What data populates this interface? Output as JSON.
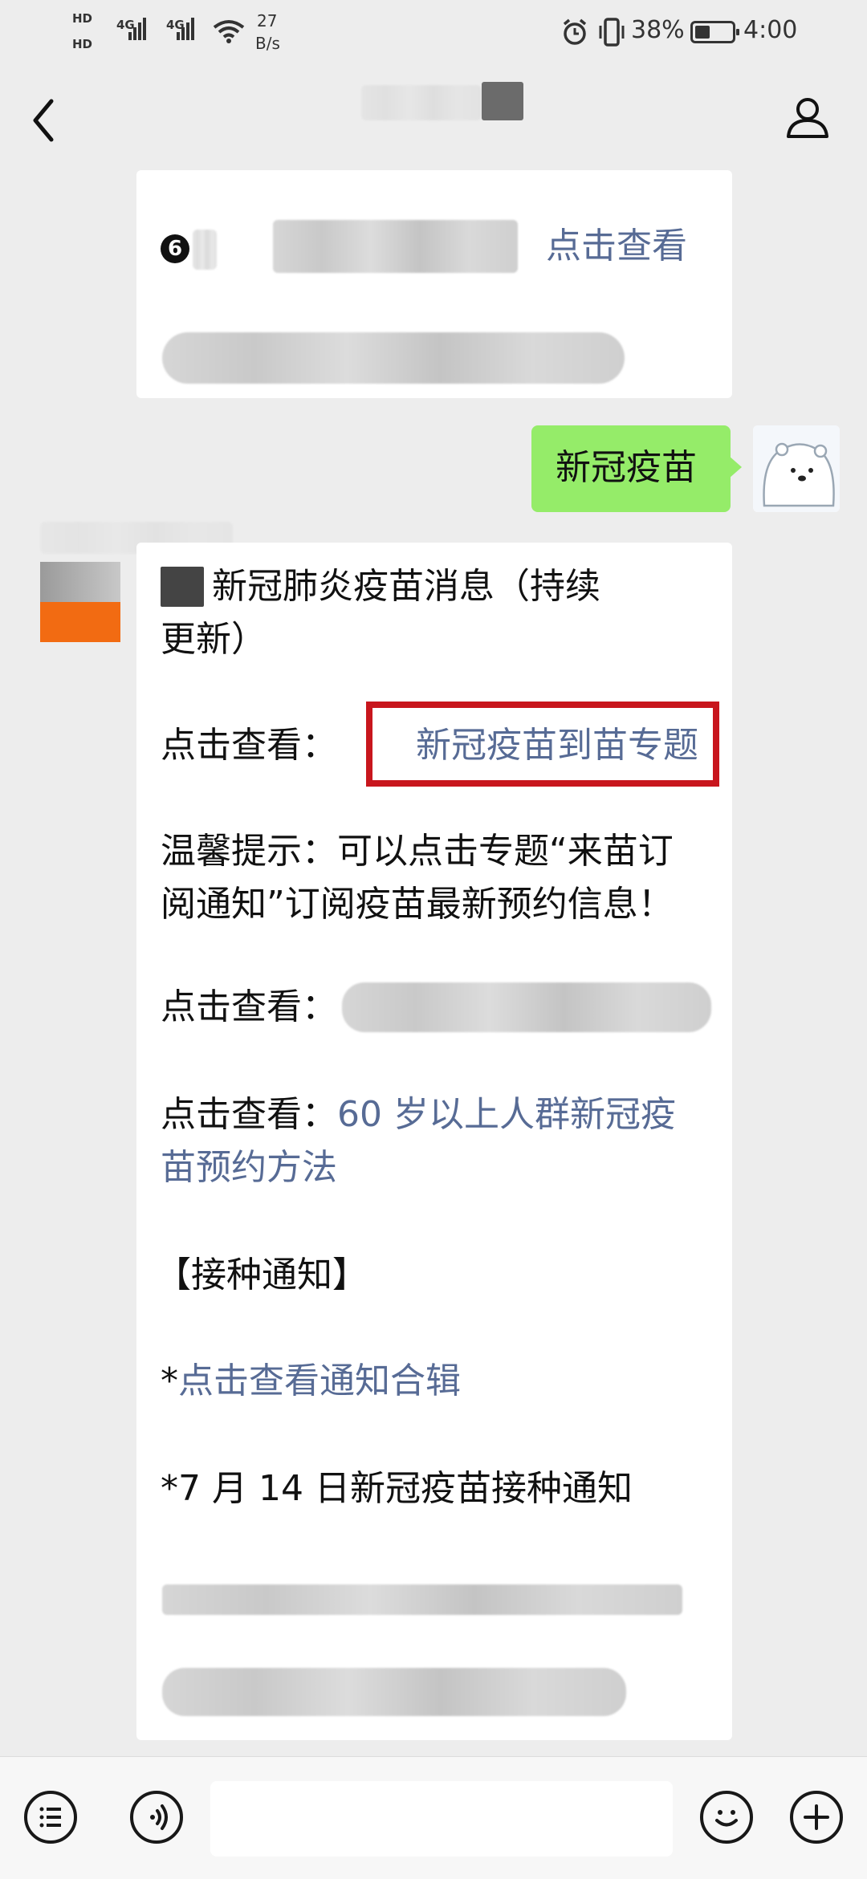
{
  "status_bar": {
    "hd1": "HD",
    "hd2": "HD",
    "net1": "4G",
    "net2": "4G",
    "speed_value": "27",
    "speed_unit": "B/s",
    "battery": "38%",
    "time": "4:00"
  },
  "nav": {
    "back_icon": "chevron-left-icon",
    "profile_icon": "person-icon"
  },
  "first_card": {
    "number": "6",
    "link": "点击查看"
  },
  "sent_message": {
    "text": "新冠疫苗"
  },
  "reply": {
    "title": "新冠肺炎疫苗消息（持续更新）",
    "line1_label": "点击查看：",
    "line1_link": "新冠疫苗到苗专题",
    "highlight_color": "#c8161d",
    "tip": "温馨提示：可以点击专题“来苗订阅通知”订阅疫苗最新预约信息！",
    "line2_label": "点击查看：",
    "line3_label": "点击查看：",
    "line3_link": "60 岁以上人群新冠疫苗预约方法",
    "section": "【接种通知】",
    "notice1_star": "*",
    "notice1_link": "点击查看通知合辑",
    "notice2": "*7 月 14 日新冠疫苗接种通知"
  },
  "bottom": {
    "list_icon": "list-icon",
    "voice_icon": "voice-icon",
    "emoji_icon": "emoji-icon",
    "plus_icon": "plus-icon"
  },
  "colors": {
    "link": "#576b95",
    "bubble_green": "#95ec69",
    "background": "#ededed"
  }
}
